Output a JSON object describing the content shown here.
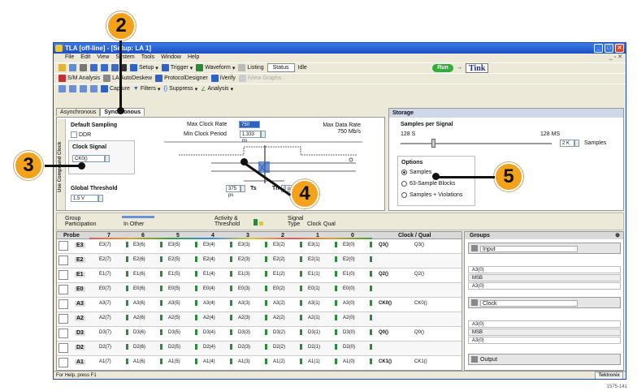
{
  "window": {
    "title": "TLA [off-line] - [Setup: LA 1]",
    "minimize_icon": "minimize-icon",
    "maximize_icon": "maximize-icon",
    "close_icon": "close-icon",
    "mdi_controls": "_ ▫ ✕"
  },
  "menu": [
    "File",
    "Edit",
    "View",
    "System",
    "Tools",
    "Window",
    "Help"
  ],
  "toolbar1": {
    "setup": "Setup",
    "trigger": "Trigger",
    "waveform": "Waveform",
    "listing": "Listing",
    "status": "Status",
    "status_value": "Idle",
    "run": "Run",
    "arrow": "→",
    "tink": "Tink"
  },
  "toolbar2": {
    "sm_analysis": "S/M Analysis",
    "autodeskew": "LA AutoDeskew",
    "protocol": "ProtocolDesigner",
    "verify": "iVerify",
    "vs": "iView Graphs"
  },
  "toolbar3": {
    "capture": "Capture",
    "filters": "Filters",
    "suppress": "Suppress",
    "analysis": "Analysis"
  },
  "tabs": {
    "async": "Asynchronous",
    "sync": "Synchronous"
  },
  "cfg": {
    "side": "Use Compound Clock",
    "default_sampling": "Default Sampling",
    "ddr": "DDR",
    "clock_signal": "Clock Signal",
    "clock_value": "CK0()",
    "global_threshold": "Global Threshold",
    "threshold_value": "1.5 V",
    "max_clock_rate": "Max Clock Rate",
    "max_clock_value": "750 MHz",
    "min_clock_period": "Min Clock Period",
    "min_clock_value": "1.333 ns",
    "max_data_rate": "Max Data Rate",
    "max_data_value": "750 Mb/s",
    "ts_value": "375 ps",
    "ts": "Ts",
    "th": "Th",
    "th_value": "0 ps"
  },
  "storage": {
    "header": "Storage",
    "samples_per_signal": "Samples per Signal",
    "min": "128 S",
    "max": "128 MS",
    "value": "2 K",
    "unit": "Samples",
    "options": "Options",
    "opt1": "Samples",
    "opt2": "63-Sample Blocks",
    "opt3": "Samples + Violations"
  },
  "legend": {
    "group": "Group Participation",
    "in_other": "In Other",
    "activity": "Activity & Threshold",
    "signal_type": "Signal Type",
    "clock": "Clock",
    "qual": "Qual"
  },
  "grid": {
    "probe": "Probe",
    "cols": [
      "7",
      "6",
      "5",
      "4",
      "3",
      "2",
      "1",
      "0"
    ],
    "clock_qual": "Clock / Qual",
    "rows": [
      {
        "name": "E3",
        "cells": [
          "E3(7)",
          "E3(6)",
          "E3(5)",
          "E3(4)",
          "E3(3)",
          "E3(2)",
          "E3(1)",
          "E3(0)"
        ],
        "cq": [
          "Q3()",
          "Q3()"
        ]
      },
      {
        "name": "E2",
        "cells": [
          "E2(7)",
          "E2(6)",
          "E2(5)",
          "E2(4)",
          "E2(3)",
          "E2(2)",
          "E2(1)",
          "E2(0)"
        ],
        "cq": [
          "",
          ""
        ]
      },
      {
        "name": "E1",
        "cells": [
          "E1(7)",
          "E1(6)",
          "E1(5)",
          "E1(4)",
          "E1(3)",
          "E1(2)",
          "E1(1)",
          "E1(0)"
        ],
        "cq": [
          "Q2()",
          "Q2()"
        ]
      },
      {
        "name": "E0",
        "cells": [
          "E0(7)",
          "E0(6)",
          "E0(5)",
          "E0(4)",
          "E0(3)",
          "E0(2)",
          "E0(1)",
          "E0(0)"
        ],
        "cq": [
          "",
          ""
        ]
      },
      {
        "name": "A3",
        "cells": [
          "A3(7)",
          "A3(6)",
          "A3(5)",
          "A3(4)",
          "A3(3)",
          "A3(2)",
          "A3(1)",
          "A3(0)"
        ],
        "cq": [
          "CK0()",
          "CK0()"
        ]
      },
      {
        "name": "A2",
        "cells": [
          "A2(7)",
          "A2(6)",
          "A2(5)",
          "A2(4)",
          "A2(3)",
          "A2(2)",
          "A2(1)",
          "A2(0)"
        ],
        "cq": [
          "",
          ""
        ]
      },
      {
        "name": "D3",
        "cells": [
          "D3(7)",
          "D3(6)",
          "D3(5)",
          "D3(4)",
          "D3(3)",
          "D3(2)",
          "D3(1)",
          "D3(0)"
        ],
        "cq": [
          "Q0()",
          "Q0()"
        ]
      },
      {
        "name": "D2",
        "cells": [
          "D2(7)",
          "D2(6)",
          "D2(5)",
          "D2(4)",
          "D2(3)",
          "D2(2)",
          "D2(1)",
          "D2(0)"
        ],
        "cq": [
          "",
          ""
        ]
      },
      {
        "name": "A1",
        "cells": [
          "A1(7)",
          "A1(6)",
          "A1(5)",
          "A1(4)",
          "A1(3)",
          "A1(2)",
          "A1(1)",
          "A1(0)"
        ],
        "cq": [
          "CK1()",
          "CK1()"
        ]
      }
    ]
  },
  "groups": {
    "header": "Groups",
    "items": [
      {
        "name": "Input",
        "f1": "A3(0)",
        "f2": "MSB",
        "f3": "A3(0)",
        "lsb": "LSB"
      },
      {
        "name": "Clock",
        "f1": "A3(0)",
        "f2": "MSB",
        "f3": "A3(0)",
        "lsb": "LSB"
      },
      {
        "name": "Output"
      }
    ]
  },
  "status": {
    "help": "For Help, press F1",
    "tek": "Tektronix"
  },
  "callouts": [
    "2",
    "3",
    "4",
    "5"
  ],
  "figure_id": "1575-141"
}
